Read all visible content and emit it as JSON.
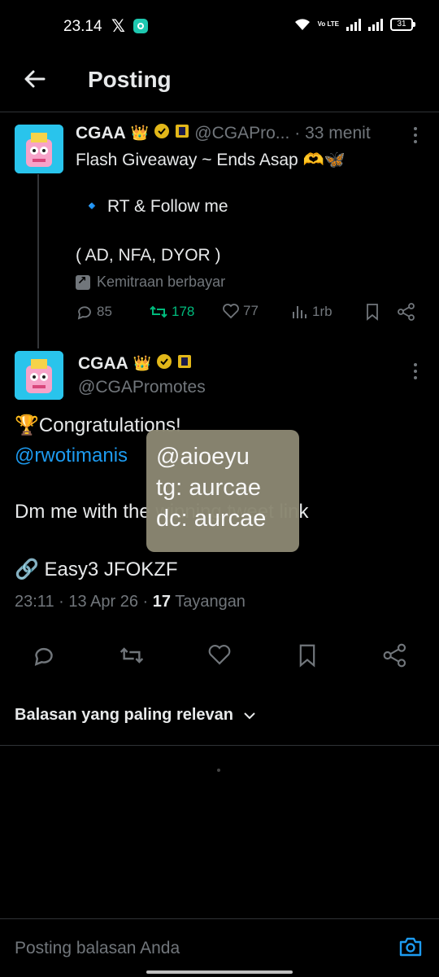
{
  "status_bar": {
    "time": "23.14",
    "x_logo": "𝕏",
    "volte": "Vo LTE",
    "battery": "31"
  },
  "header": {
    "title": "Posting"
  },
  "quoted_tweet": {
    "name": "CGAA",
    "badges": [
      "👑",
      "✓",
      "🀄"
    ],
    "handle": "@CGAPro...",
    "time": "· 33 menit",
    "line1": "Flash Giveaway ~ Ends Asap 🫶🦋",
    "line2": "🔹 RT & Follow me",
    "line3": "( AD, NFA, DYOR )",
    "partnership": "Kemitraan berbayar",
    "stats": {
      "replies": "85",
      "reposts": "178",
      "likes": "77",
      "views": "1rb"
    }
  },
  "main_tweet": {
    "name": "CGAA",
    "handle": "@CGAPromotes",
    "line1": "🏆Congratulations!",
    "mention": "@rwotimanis",
    "line2": "Dm me with the winning tweet link",
    "line3": "🔗 Easy3 JFOKZF",
    "time": "23:11 · 13 Apr 26 · ",
    "views_count": "17",
    "views_label": " Tayangan"
  },
  "overlay": {
    "line1": "@aioeyu",
    "line2": "tg: aurcae",
    "line3": "dc: aurcae"
  },
  "replies": {
    "sort_label": "Balasan yang paling relevan"
  },
  "reply_bar": {
    "placeholder": "Posting balasan Anda"
  },
  "colors": {
    "background": "#000000",
    "text": "#e7e9ea",
    "muted": "#71767b",
    "accent": "#1d9bf0",
    "repost_green": "#00ba7c",
    "overlay": "#8b8772"
  }
}
